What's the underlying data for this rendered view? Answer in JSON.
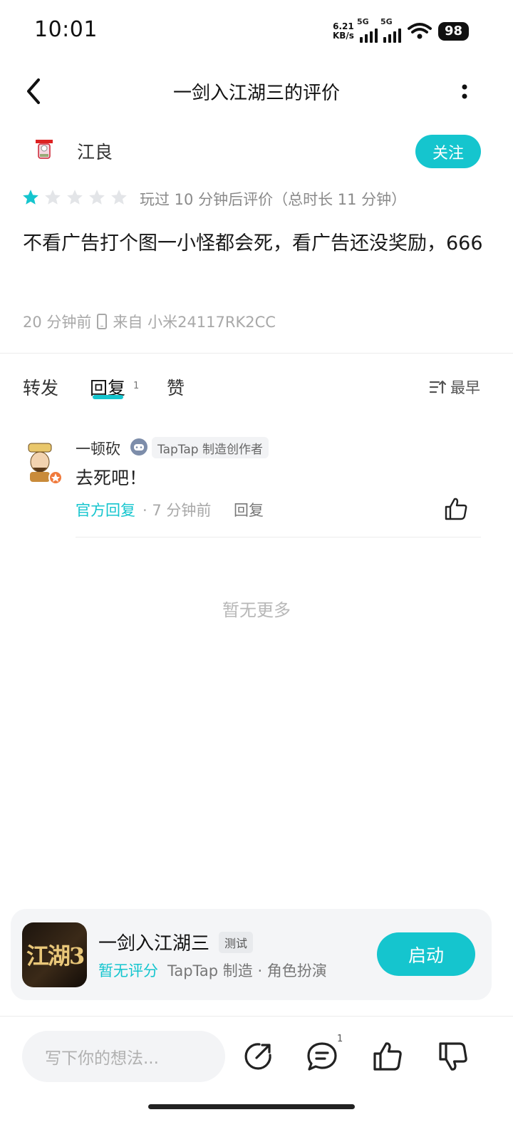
{
  "status_bar": {
    "time": "10:01",
    "net_speed_value": "6.21",
    "net_speed_unit": "KB/s",
    "signal1_label": "5G",
    "signal2_label": "5G",
    "battery": "98"
  },
  "header": {
    "title": "一剑入江湖三的评价"
  },
  "author": {
    "name": "江良",
    "follow_label": "关注"
  },
  "rating": {
    "stars": 1,
    "max_stars": 5,
    "note": "玩过 10 分钟后评价（总时长 11 分钟）"
  },
  "review": {
    "content": "不看广告打个图一小怪都会死，看广告还没奖励，666",
    "time": "20 分钟前",
    "source": "来自 小米24117RK2CC"
  },
  "tabs": {
    "repost": "转发",
    "reply": "回复",
    "reply_count": "1",
    "like": "赞",
    "sort_label": "最早"
  },
  "comment": {
    "name": "一顿砍",
    "badge": "TapTap 制造创作者",
    "text": "去死吧！",
    "official_label": "官方回复",
    "time": "· 7 分钟前",
    "reply_label": "回复"
  },
  "no_more": "暂无更多",
  "game": {
    "icon_text": "江湖3",
    "name": "一剑入江湖三",
    "tag": "测试",
    "rating_text": "暂无评分",
    "meta": "TapTap 制造 · 角色扮演",
    "launch_label": "启动"
  },
  "bottom_bar": {
    "input_placeholder": "写下你的想法...",
    "comment_count": "1"
  },
  "colors": {
    "accent": "#15c5ce",
    "star_empty": "#e3e5e8"
  }
}
